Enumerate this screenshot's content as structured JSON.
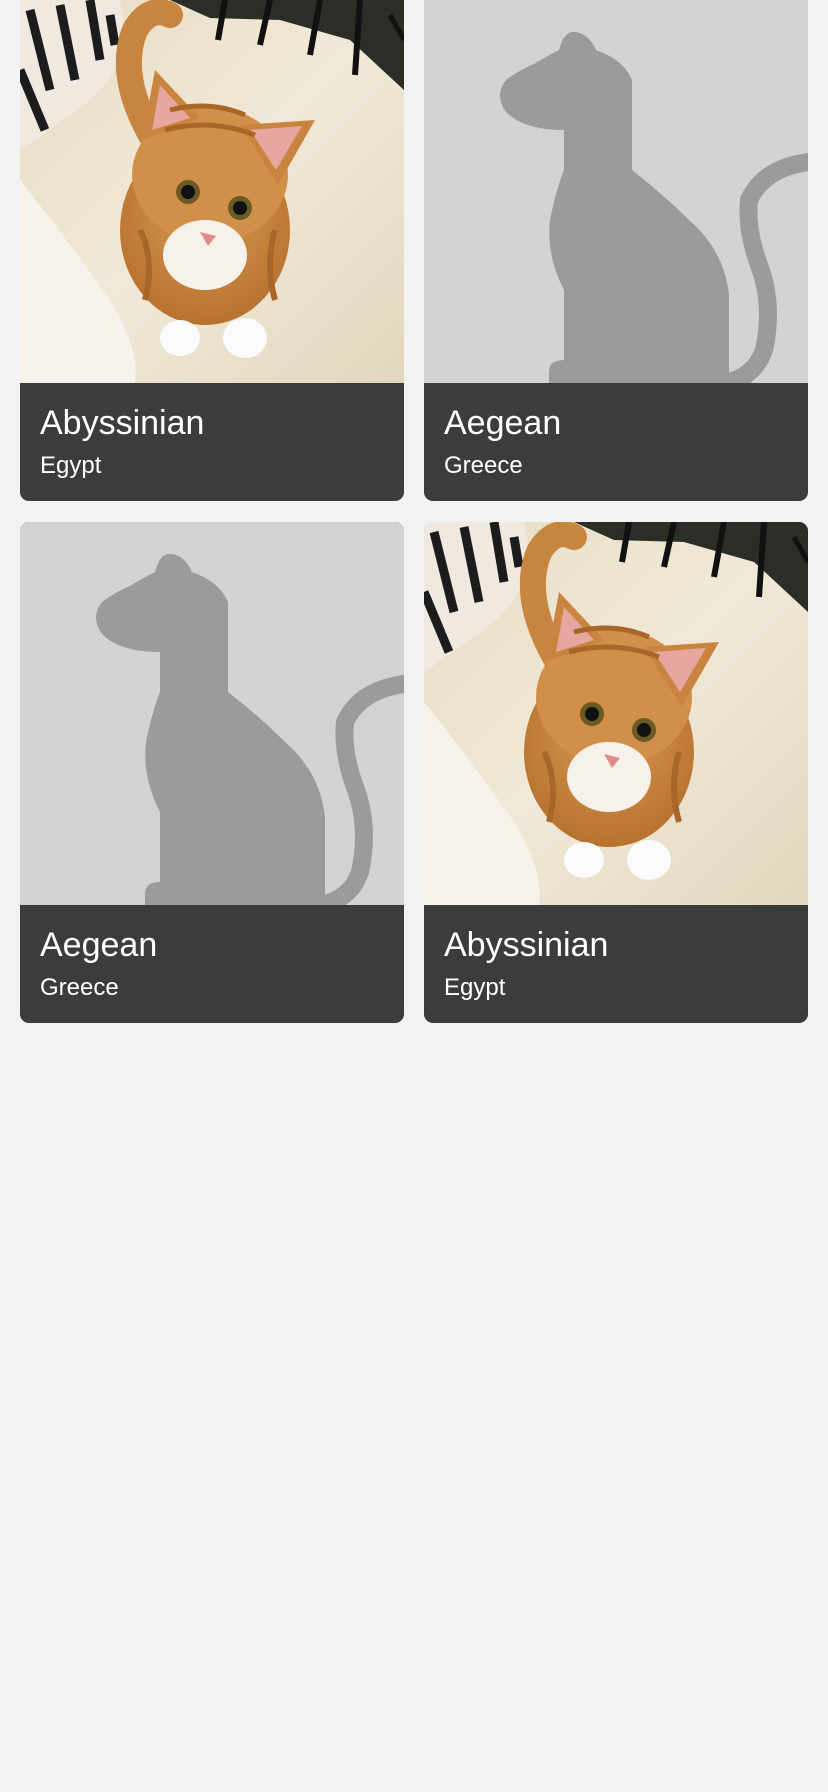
{
  "breeds": [
    {
      "name": "Abyssinian",
      "origin": "Egypt",
      "image": "cat-photo"
    },
    {
      "name": "Aegean",
      "origin": "Greece",
      "image": "cat-placeholder"
    },
    {
      "name": "Aegean",
      "origin": "Greece",
      "image": "cat-placeholder"
    },
    {
      "name": "Abyssinian",
      "origin": "Egypt",
      "image": "cat-photo"
    }
  ],
  "colors": {
    "background": "#f2f2f2",
    "card_info": "#3c3c3c",
    "placeholder_bg": "#d3d3d3",
    "placeholder_silhouette": "#9b9b9b",
    "text": "#ffffff"
  }
}
